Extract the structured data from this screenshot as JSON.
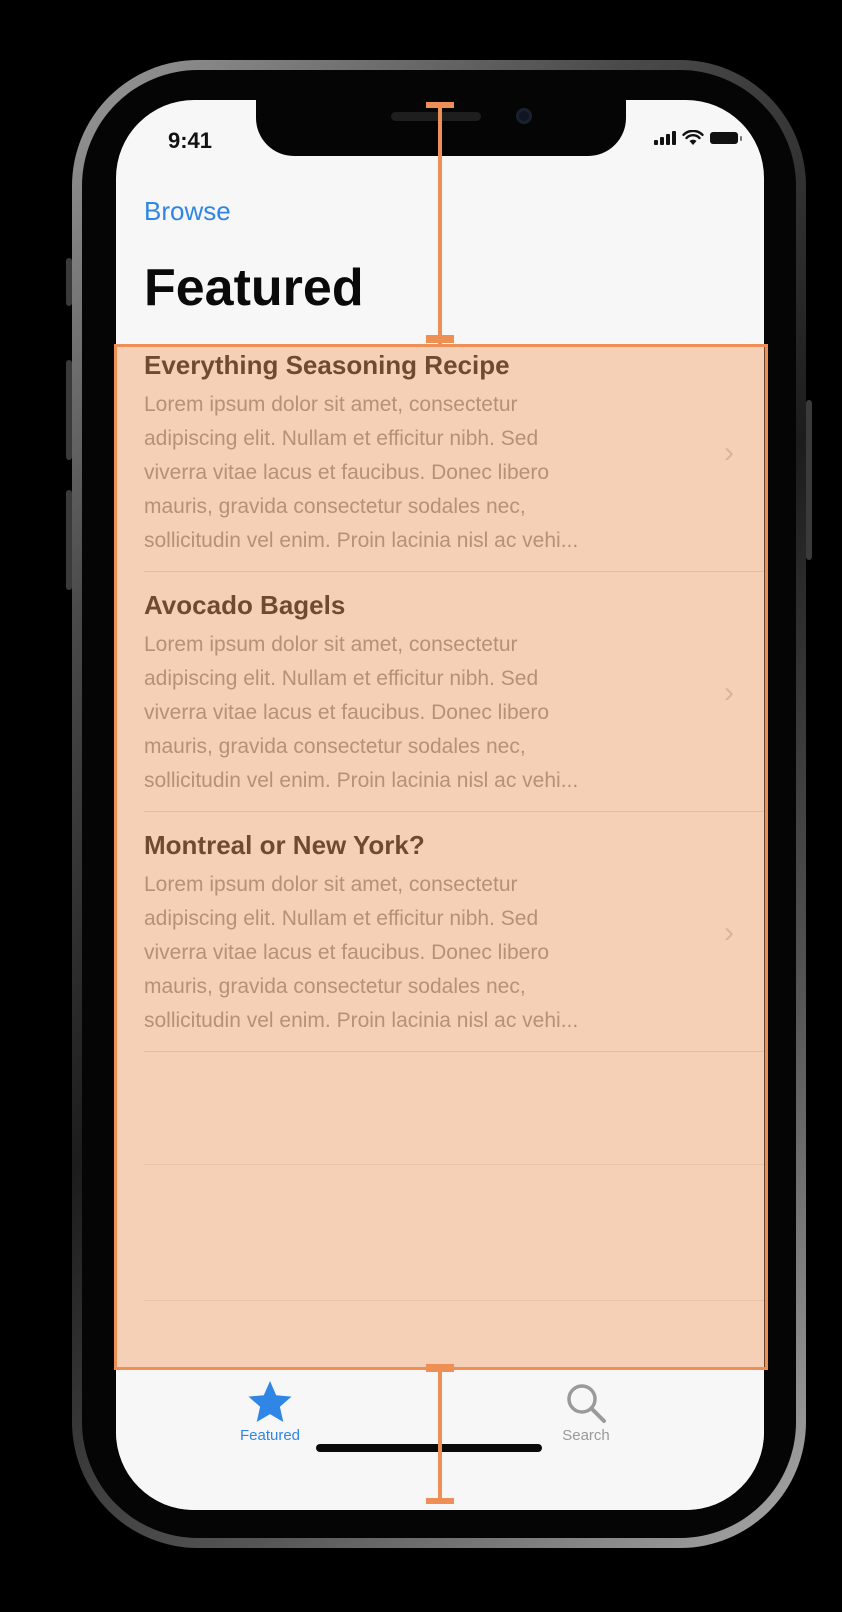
{
  "status_bar": {
    "time": "9:41"
  },
  "nav": {
    "back_label": "Browse",
    "title": "Featured"
  },
  "items": [
    {
      "title": "Everything Seasoning Recipe",
      "body_lines": [
        "Lorem ipsum dolor sit amet, consectetur",
        "adipiscing elit. Nullam et efficitur nibh. Sed",
        "viverra vitae lacus et faucibus. Donec libero",
        "mauris, gravida consectetur sodales nec,",
        "sollicitudin vel enim. Proin lacinia nisl ac vehi..."
      ]
    },
    {
      "title": "Avocado Bagels",
      "body_lines": [
        "Lorem ipsum dolor sit amet, consectetur",
        "adipiscing elit. Nullam et efficitur nibh. Sed",
        "viverra vitae lacus et faucibus. Donec libero",
        "mauris, gravida consectetur sodales nec,",
        "sollicitudin vel enim. Proin lacinia nisl ac vehi..."
      ]
    },
    {
      "title": "Montreal or New York?",
      "body_lines": [
        "Lorem ipsum dolor sit amet, consectetur",
        "adipiscing elit. Nullam et efficitur nibh. Sed",
        "viverra vitae lacus et faucibus. Donec libero",
        "mauris, gravida consectetur sodales nec,",
        "sollicitudin vel enim. Proin lacinia nisl ac vehi..."
      ]
    }
  ],
  "tabs": [
    {
      "label": "Featured",
      "icon": "star-icon",
      "active": true
    },
    {
      "label": "Search",
      "icon": "search-icon",
      "active": false
    }
  ],
  "colors": {
    "accent": "#2f86e6",
    "inactive_tab": "#9a9a9a",
    "overlay": "#f6985f",
    "overlay_border": "#ee9056"
  }
}
